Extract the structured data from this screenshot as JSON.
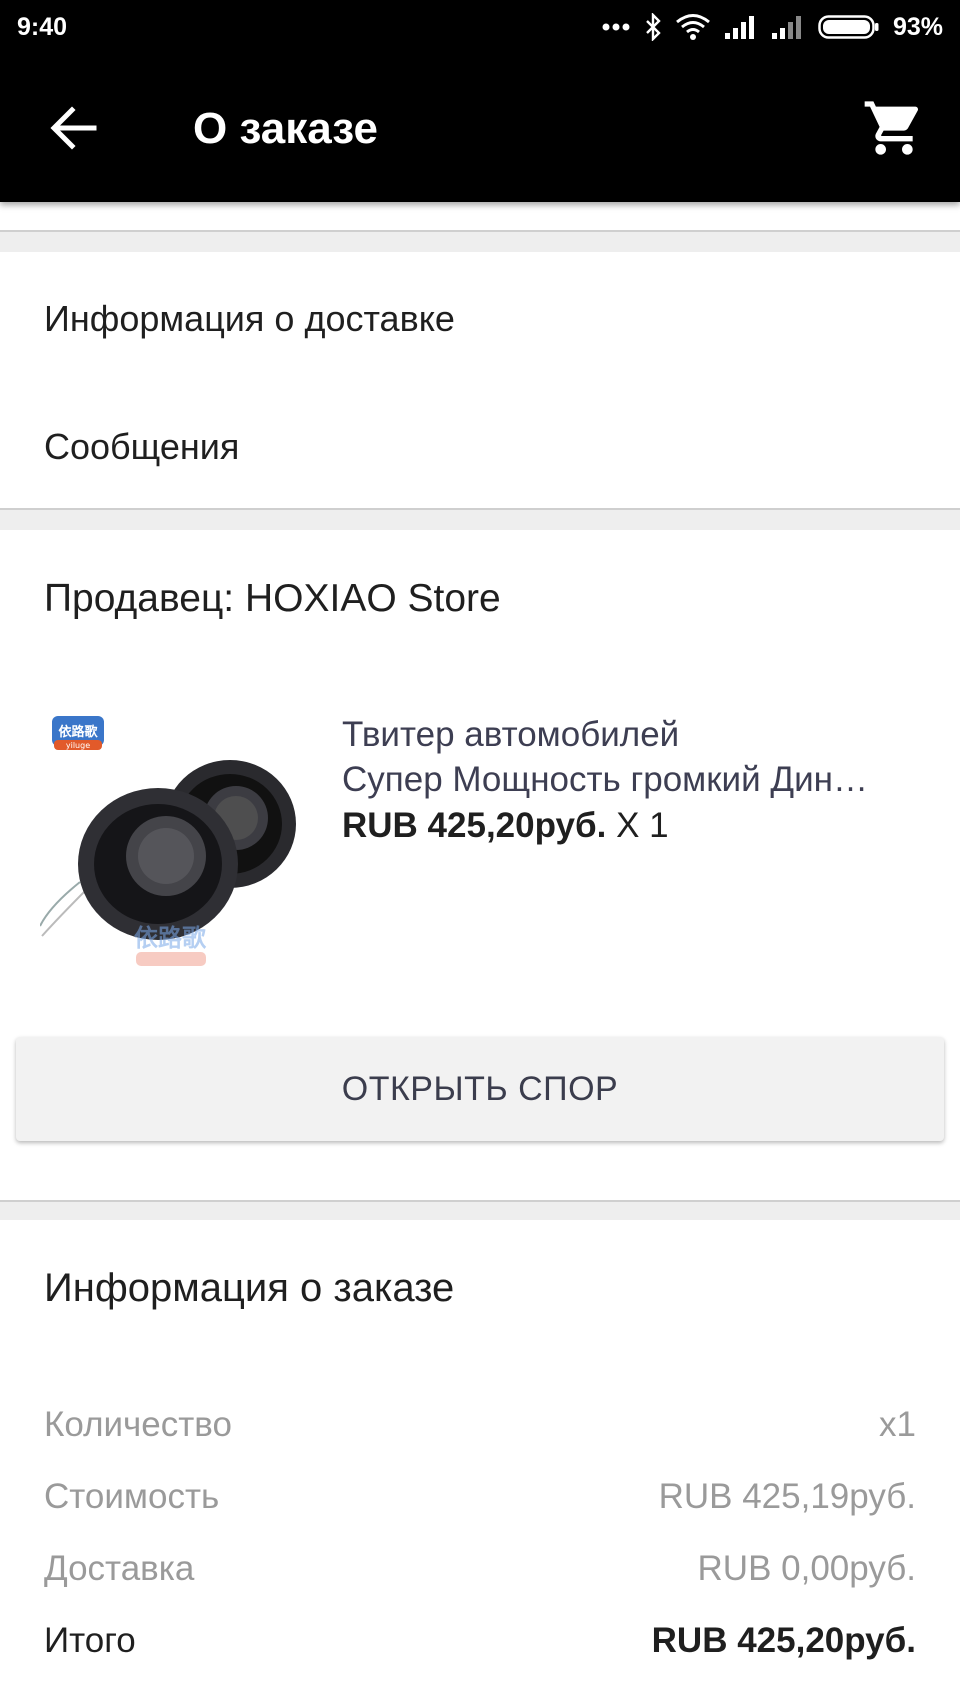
{
  "status_bar": {
    "time": "9:40",
    "battery_percent": "93%",
    "icons": [
      "more-dots-icon",
      "bluetooth-icon",
      "wifi-icon",
      "signal-icon",
      "signal-icon",
      "battery-icon"
    ]
  },
  "app_bar": {
    "title": "О заказе",
    "back_icon": "arrow-left-icon",
    "cart_icon": "cart-icon"
  },
  "sections": {
    "delivery_info": "Информация о доставке",
    "messages": "Сообщения"
  },
  "seller": {
    "label": "Продавец: HOXIAO Store"
  },
  "product": {
    "title_line1": "Твитер автомобилей",
    "title_line2": "Супер Мощность громкий Дин…",
    "price": "RUB 425,20руб.",
    "qty": "X 1",
    "image_brand_text": "yiluge"
  },
  "dispute_button": "ОТКРЫТЬ СПОР",
  "order_info": {
    "title": "Информация о заказе",
    "rows": [
      {
        "label": "Количество",
        "value": "x1"
      },
      {
        "label": "Стоимость",
        "value": "RUB 425,19руб."
      },
      {
        "label": "Доставка",
        "value": "RUB 0,00руб."
      },
      {
        "label": "Итого",
        "value": "RUB 425,20руб."
      }
    ]
  },
  "colors": {
    "app_bar": "#000000",
    "background": "#eeeeee",
    "muted_text": "#9a9a9a",
    "product_text": "#3d3e52"
  }
}
